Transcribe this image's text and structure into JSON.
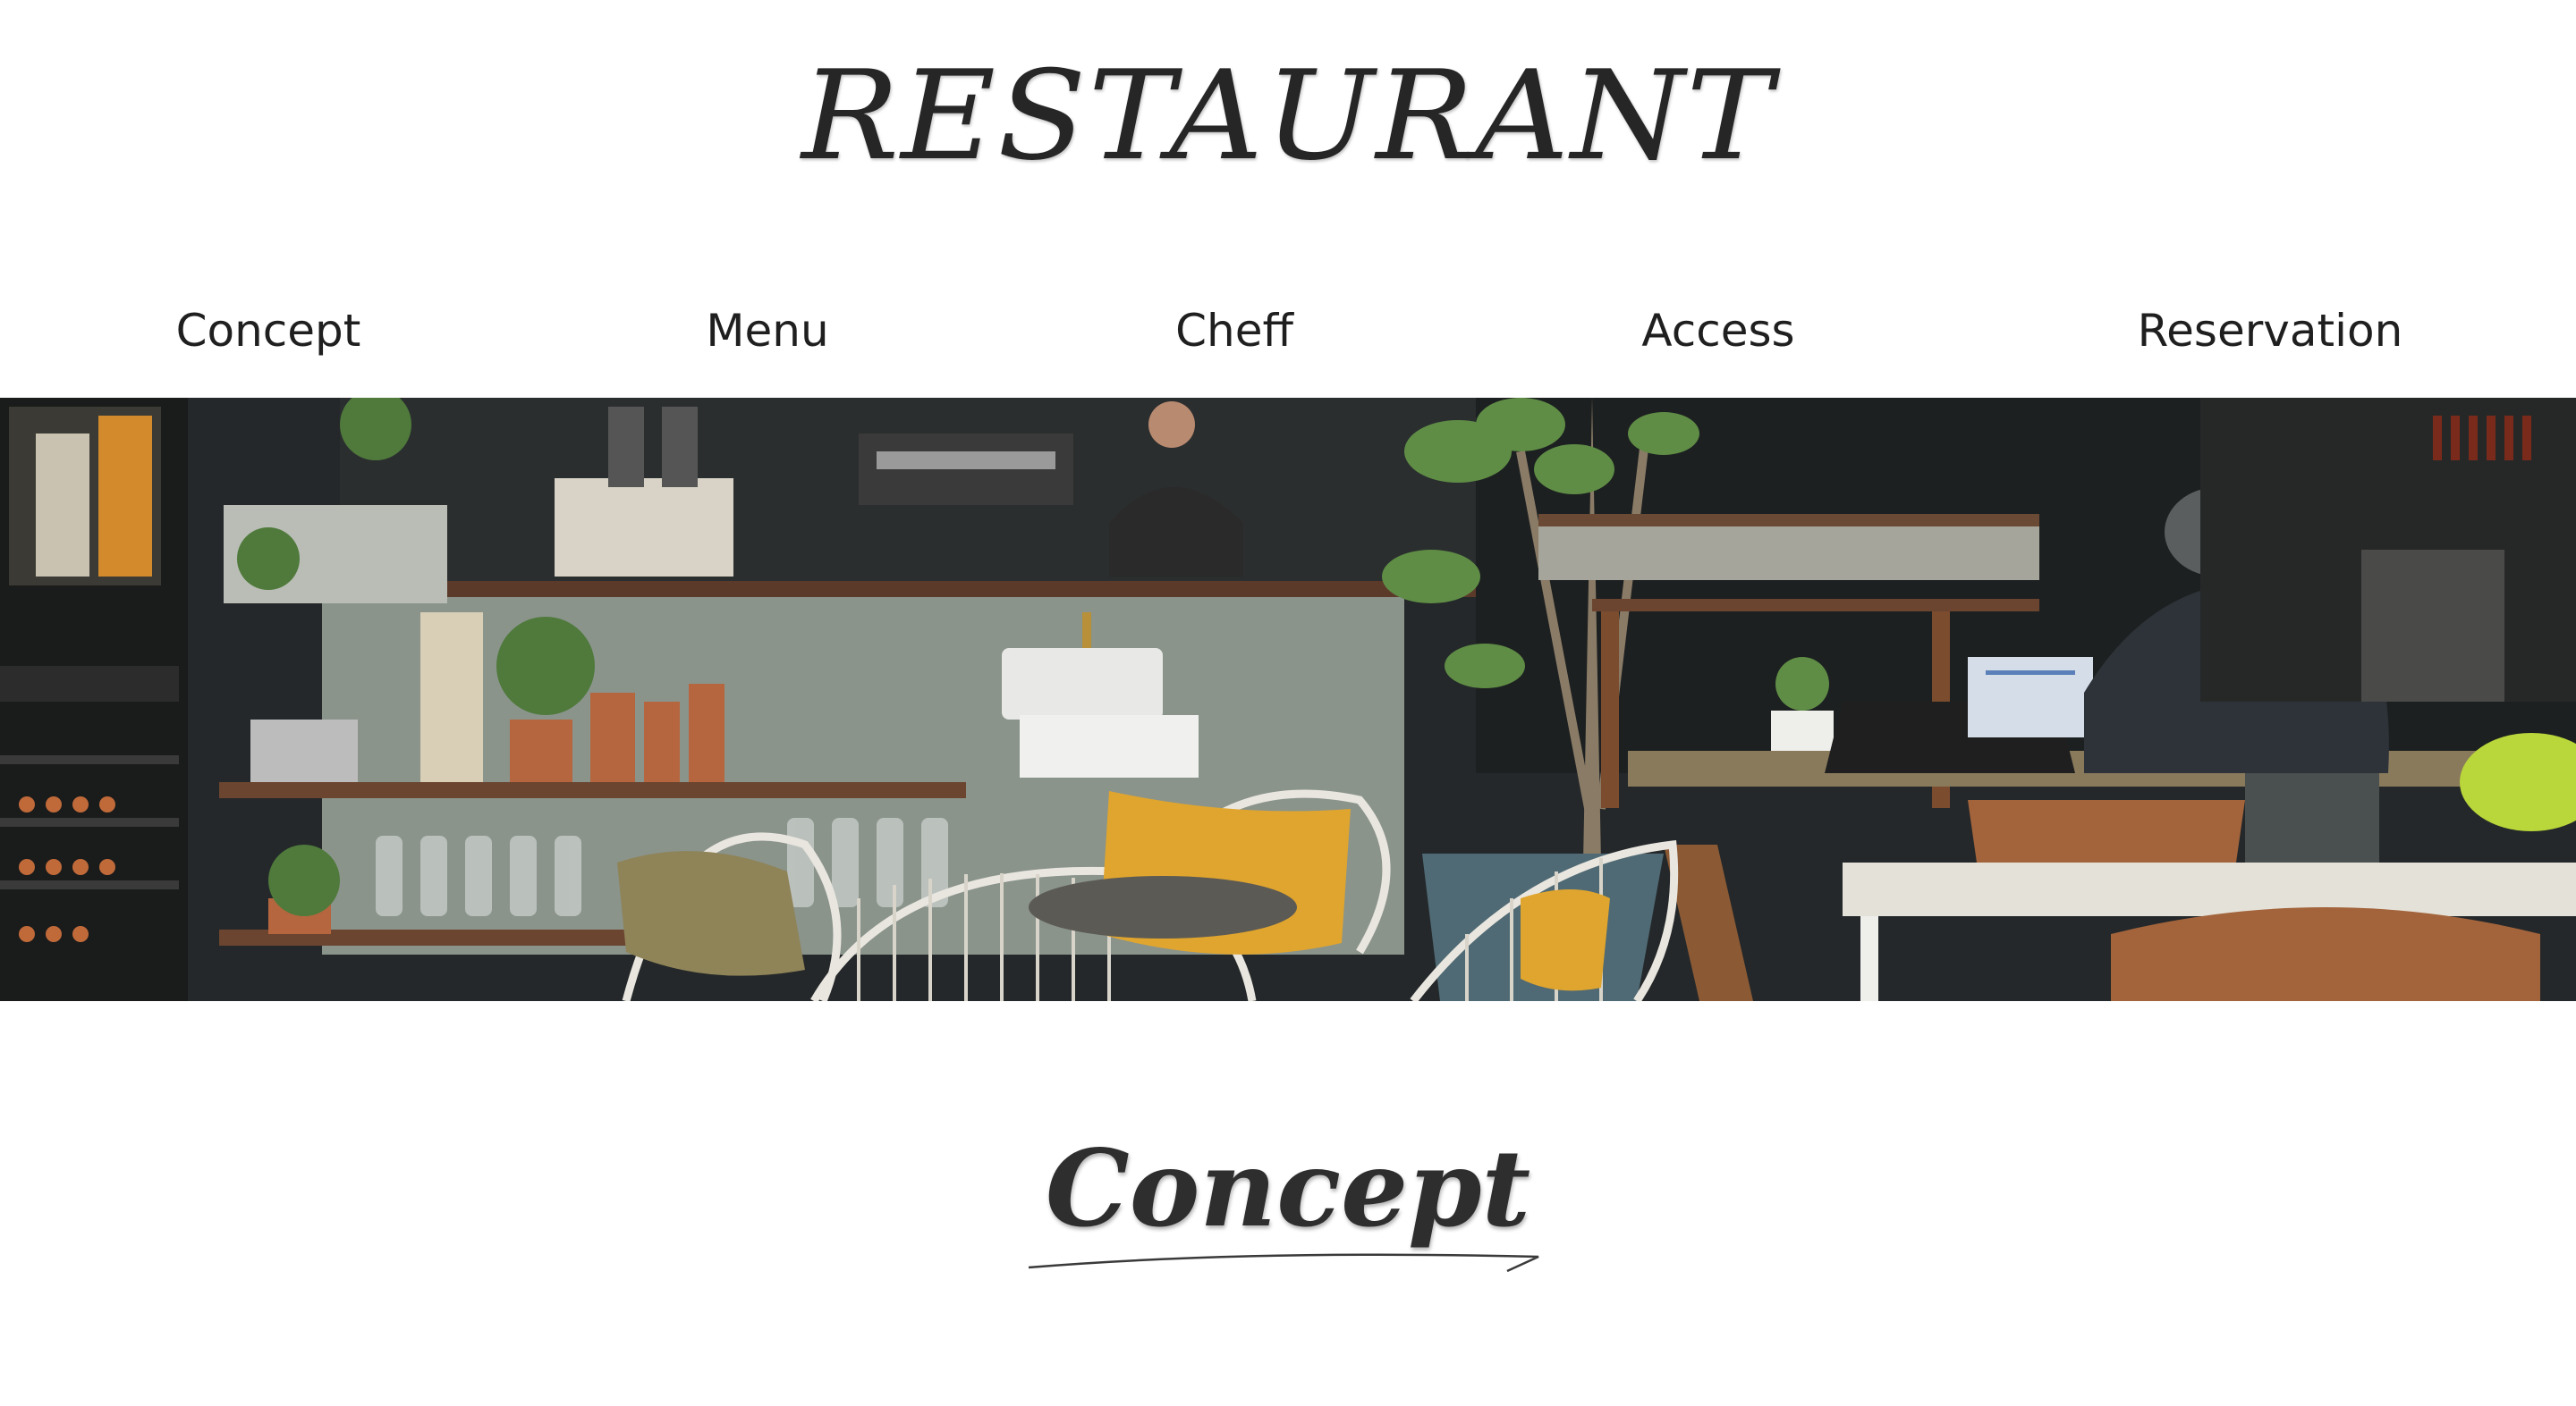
{
  "brand": {
    "logo_text": "RESTAURANT"
  },
  "nav": {
    "items": [
      {
        "label": "Concept"
      },
      {
        "label": "Menu"
      },
      {
        "label": "Cheff"
      },
      {
        "label": "Access"
      },
      {
        "label": "Reservation"
      }
    ]
  },
  "hero": {
    "image_icon": "cafe-interior-photo"
  },
  "sections": {
    "concept": {
      "title": "Concept"
    }
  },
  "colors": {
    "background": "#ffffff",
    "text": "#1f1f1f",
    "heading": "#2e2e2e",
    "cushion": "#e0a52e",
    "wall": "#8a948b"
  }
}
